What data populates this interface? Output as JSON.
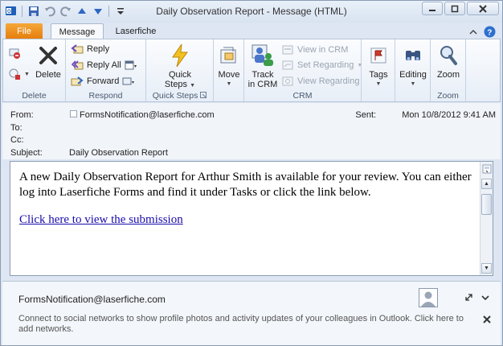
{
  "window": {
    "title": "Daily Observation Report - Message (HTML)"
  },
  "tabs": {
    "file": "File",
    "message": "Message",
    "laserfiche": "Laserfiche"
  },
  "ribbon": {
    "delete_group": {
      "label": "Delete",
      "delete": "Delete"
    },
    "respond_group": {
      "label": "Respond",
      "reply": "Reply",
      "reply_all": "Reply All",
      "forward": "Forward"
    },
    "quick_steps_group": {
      "label": "Quick Steps",
      "quick_steps_line1": "Quick",
      "quick_steps_line2": "Steps"
    },
    "move_group": {
      "move": "Move"
    },
    "crm_group": {
      "label": "CRM",
      "track_line1": "Track",
      "track_line2": "in CRM",
      "view_in_crm": "View in CRM",
      "set_regarding": "Set Regarding",
      "view_regarding": "View Regarding"
    },
    "tags_group": {
      "tags": "Tags"
    },
    "editing_group": {
      "editing": "Editing"
    },
    "zoom_group": {
      "label": "Zoom",
      "zoom": "Zoom"
    }
  },
  "header": {
    "from_label": "From:",
    "from_value": "FormsNotification@laserfiche.com",
    "to_label": "To:",
    "cc_label": "Cc:",
    "subject_label": "Subject:",
    "subject_value": "Daily Observation Report",
    "sent_label": "Sent:",
    "sent_value": "Mon 10/8/2012 9:41 AM"
  },
  "message": {
    "paragraph": "A new Daily Observation Report for Arthur Smith is available for your review. You can either log into Laserfiche Forms and find it under Tasks or click the link below.",
    "link": "Click here to view the submission"
  },
  "people_pane": {
    "email": "FormsNotification@laserfiche.com",
    "info": "Connect to social networks to show profile photos and activity updates of your colleagues in Outlook. Click here to add networks."
  },
  "colors": {
    "file_tab": "#e57c0a",
    "link": "#1a0dab",
    "accent": "#dde6f2"
  }
}
